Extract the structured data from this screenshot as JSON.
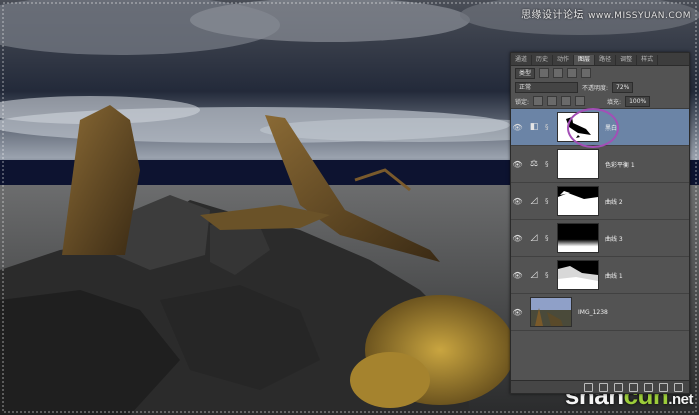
{
  "watermark_top": {
    "cn": "思缘设计论坛",
    "en": "www.MISSYUAN.COM"
  },
  "watermark_bottom": {
    "part1": "shan",
    "part2": "cun",
    "dot": ".",
    "tld": "net"
  },
  "panel": {
    "tabs": [
      "通道",
      "历史",
      "动作",
      "图层",
      "路径",
      "调整",
      "样式"
    ],
    "active_tab": "图层",
    "filter_label": "类型",
    "blend_mode": "正常",
    "opacity_label": "不透明度:",
    "opacity_value": "72%",
    "lock_label": "锁定:",
    "fill_label": "填充:",
    "fill_value": "100%",
    "layers": [
      {
        "name": "黑白",
        "kind": "adjustment",
        "icon": "black-white-icon",
        "active": true
      },
      {
        "name": "色彩平衡 1",
        "kind": "adjustment",
        "icon": "balance-icon",
        "active": false
      },
      {
        "name": "曲线 2",
        "kind": "adjustment",
        "icon": "curves-icon",
        "active": false
      },
      {
        "name": "曲线 3",
        "kind": "adjustment",
        "icon": "curves-icon",
        "active": false
      },
      {
        "name": "曲线 1",
        "kind": "adjustment",
        "icon": "curves-icon",
        "active": false
      },
      {
        "name": "IMG_1238",
        "kind": "image",
        "icon": "",
        "active": false
      }
    ]
  },
  "colors": {
    "panel_bg": "#535353",
    "active_layer": "#6b84a6",
    "highlight_ring": "#a34fb6"
  }
}
